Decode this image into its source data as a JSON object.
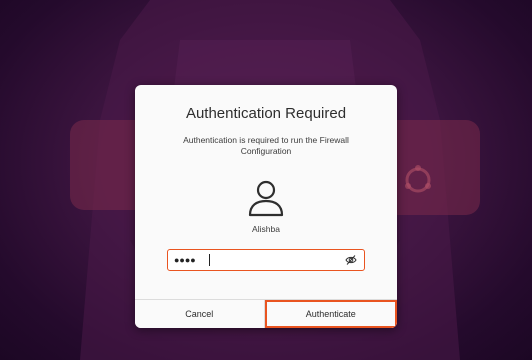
{
  "dialog": {
    "title": "Authentication Required",
    "message": "Authentication is required to run the Firewall Configuration",
    "user_icon": "user-avatar-icon",
    "username": "Alishba",
    "password": {
      "value": "●●●●",
      "masked": true,
      "reveal_icon": "eye-slash-icon"
    },
    "buttons": {
      "cancel": "Cancel",
      "authenticate": "Authenticate"
    }
  },
  "colors": {
    "accent": "#e95420",
    "dialog_bg": "#fafafa",
    "wallpaper": "#3d1540"
  }
}
